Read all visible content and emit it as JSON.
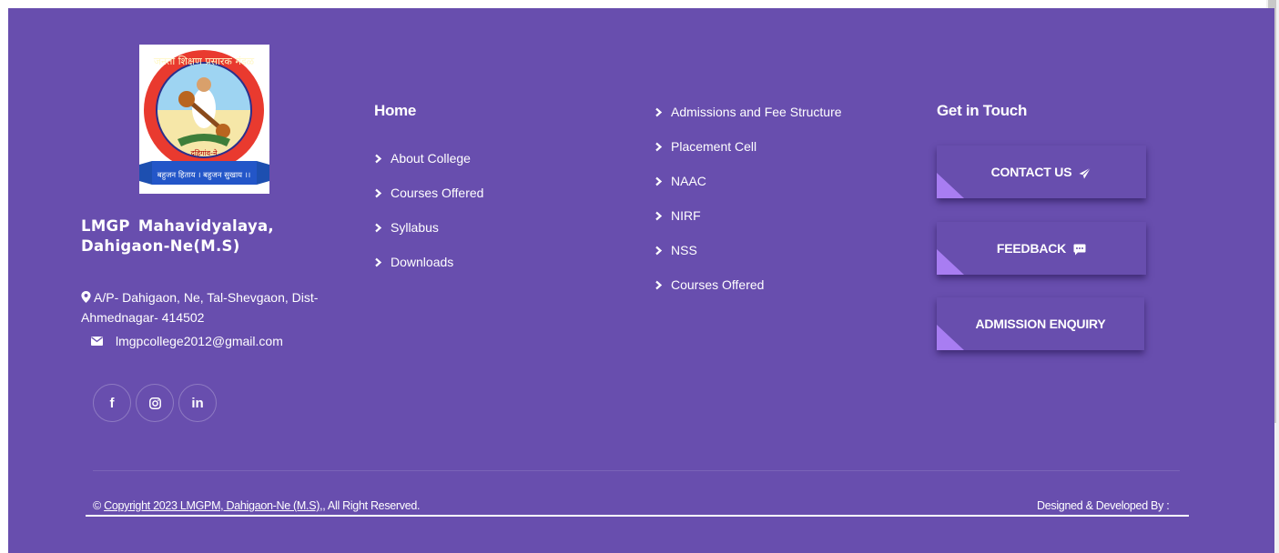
{
  "brand": {
    "name": "LMGP  Mahavidyalaya, Dahigaon-Ne(M.S)",
    "logo_text_top": "जनता शिक्षण प्रसारक मंडळ",
    "logo_text_village": "दहिगांव-ने",
    "logo_text_banner": "बहुजन हिताय । बहुजन सुखाय ।।",
    "address": "A/P- Dahigaon, Ne, Tal-Shevgaon, Dist-Ahmednagar- 414502",
    "email": "lmgpcollege2012@gmail.com"
  },
  "social": [
    {
      "icon": "facebook-icon",
      "glyph": "f"
    },
    {
      "icon": "instagram-icon",
      "glyph": ""
    },
    {
      "icon": "linkedin-icon",
      "glyph": "in"
    }
  ],
  "links_col1": {
    "title": "Home",
    "items": [
      "About College",
      "Courses Offered",
      "Syllabus",
      "Downloads"
    ]
  },
  "links_col2": {
    "items": [
      "Admissions and Fee Structure",
      "Placement Cell",
      "NAAC",
      "NIRF",
      "NSS",
      "Courses Offered"
    ]
  },
  "contact": {
    "title": "Get in Touch",
    "buttons": [
      "CONTACT US",
      "FEEDBACK",
      "ADMISSION ENQUIRY"
    ]
  },
  "bottom": {
    "copyright_prefix": "© ",
    "copyright_link": "Copyright 2023 LMGPM, Dahigaon-Ne (M.S),",
    "copyright_suffix": ", All Right Reserved.",
    "designed": "Designed & Developed By :"
  },
  "colors": {
    "footer_bg": "#684eae",
    "accent_triangle": "#a87df2",
    "text": "#ffffff"
  }
}
